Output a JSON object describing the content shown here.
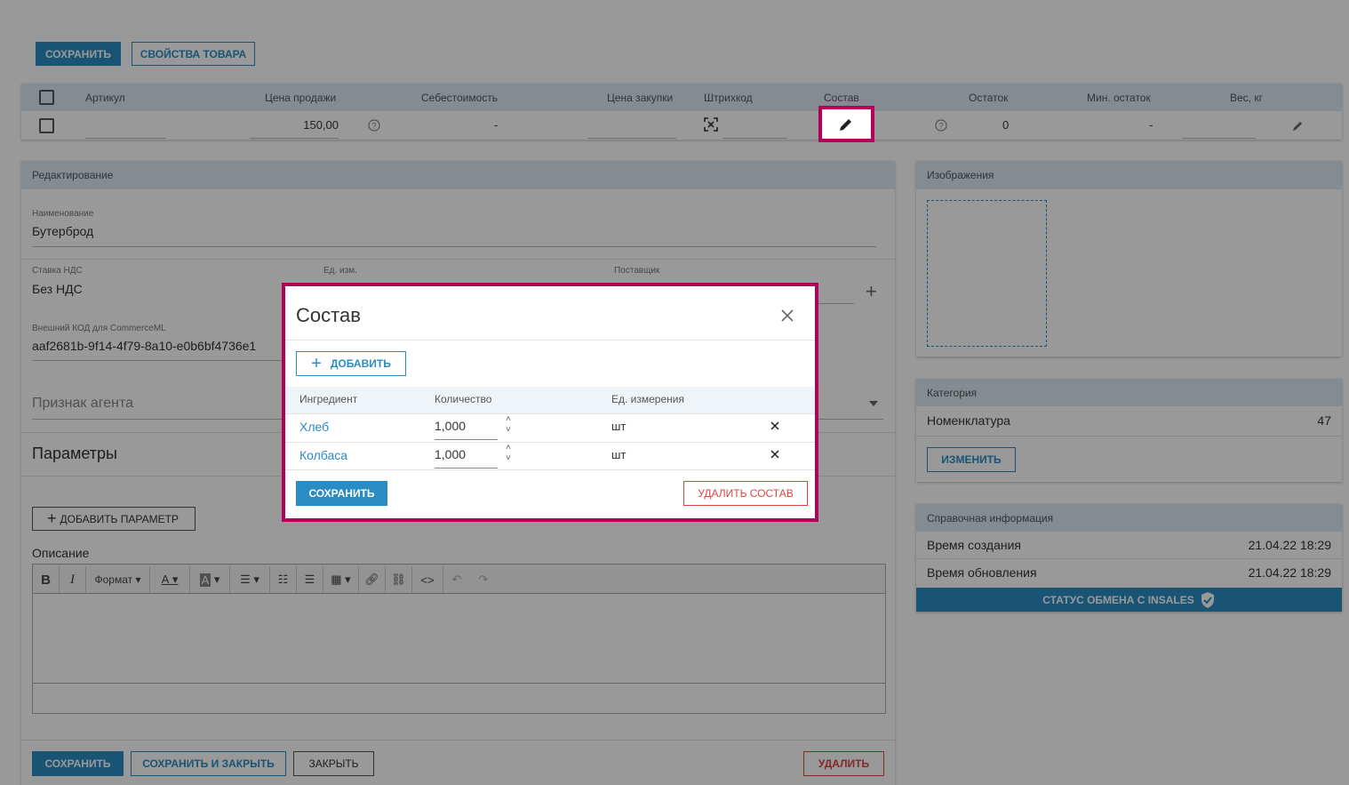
{
  "toolbar": {
    "save": "СОХРАНИТЬ",
    "props": "СВОЙСТВА ТОВАРА"
  },
  "table": {
    "headers": [
      "Артикул",
      "Цена продажи",
      "Себестоимость",
      "Цена закупки",
      "Штрихкод",
      "Состав",
      "Остаток",
      "Мин. остаток",
      "Вес, кг"
    ],
    "row": {
      "price": "150,00",
      "cost": "-",
      "stock": "0",
      "min_stock": "-"
    }
  },
  "edit": {
    "header": "Редактирование",
    "name_label": "Наименование",
    "name_value": "Бутерброд",
    "vat_label": "Ставка НДС",
    "vat_value": "Без НДС",
    "unit_label": "Ед. изм.",
    "supplier_label": "Поставщик",
    "ext_label": "Внешний КОД для CommerceML",
    "ext_value": "aaf2681b-9f14-4f79-8a10-e0b6bf4736e1",
    "agent_placeholder": "Признак агента",
    "params_title": "Параметры",
    "add_param": "ДОБАВИТЬ ПАРАМЕТР",
    "desc_label": "Описание",
    "format": "Формат"
  },
  "footer": {
    "save": "СОХРАНИТЬ",
    "save_close": "СОХРАНИТЬ И ЗАКРЫТЬ",
    "close": "ЗАКРЫТЬ",
    "delete": "УДАЛИТЬ"
  },
  "images": {
    "header": "Изображения"
  },
  "category": {
    "header": "Категория",
    "name": "Номенклатура",
    "count": "47",
    "change": "ИЗМЕНИТЬ"
  },
  "info": {
    "header": "Справочная информация",
    "created_label": "Время создания",
    "created": "21.04.22 18:29",
    "updated_label": "Время обновления",
    "updated": "21.04.22 18:29",
    "status": "СТАТУС ОБМЕНА С INSALES"
  },
  "modal": {
    "title": "Состав",
    "add": "ДОБАВИТЬ",
    "headers": [
      "Ингредиент",
      "Количество",
      "Ед. измерения"
    ],
    "rows": [
      {
        "name": "Хлеб",
        "qty": "1,000",
        "unit": "шт"
      },
      {
        "name": "Колбаса",
        "qty": "1,000",
        "unit": "шт"
      }
    ],
    "save": "СОХРАНИТЬ",
    "delete": "УДАЛИТЬ СОСТАВ"
  },
  "colors": {
    "accent": "#2b8cc4",
    "danger": "#d9463e",
    "highlight": "#b5005b",
    "header_bg": "#dce9f2"
  }
}
